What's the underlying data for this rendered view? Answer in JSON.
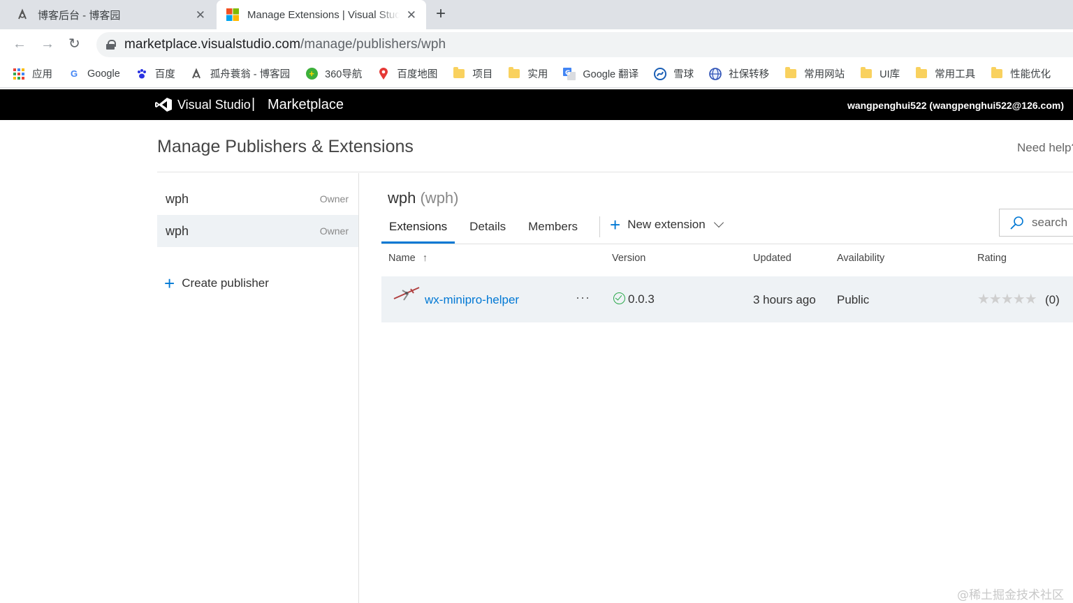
{
  "browser": {
    "tabs": [
      {
        "title": "博客后台 - 博客园",
        "active": false
      },
      {
        "title": "Manage Extensions | Visual Studio Marketplace",
        "active": true
      }
    ],
    "close_glyph": "✕",
    "new_tab_glyph": "+",
    "back_glyph": "←",
    "forward_glyph": "→",
    "reload_glyph": "↻",
    "url_host": "marketplace.visualstudio.com",
    "url_path": "/manage/publishers/wph",
    "bookmarks": [
      {
        "label": "应用",
        "icon": "apps-grid-icon"
      },
      {
        "label": "Google",
        "icon": "google-icon"
      },
      {
        "label": "百度",
        "icon": "baidu-paw-icon"
      },
      {
        "label": "孤舟蓑翁 - 博客园",
        "icon": "cnblogs-icon"
      },
      {
        "label": "360导航",
        "icon": "360-icon"
      },
      {
        "label": "百度地图",
        "icon": "map-pin-icon"
      },
      {
        "label": "项目",
        "icon": "folder-icon"
      },
      {
        "label": "实用",
        "icon": "folder-icon"
      },
      {
        "label": "Google 翻译",
        "icon": "google-translate-icon"
      },
      {
        "label": "雪球",
        "icon": "xueqiu-icon"
      },
      {
        "label": "社保转移",
        "icon": "globe-icon"
      },
      {
        "label": "常用网站",
        "icon": "folder-icon"
      },
      {
        "label": "UI库",
        "icon": "folder-icon"
      },
      {
        "label": "常用工具",
        "icon": "folder-icon"
      },
      {
        "label": "性能优化",
        "icon": "folder-icon"
      }
    ]
  },
  "header": {
    "brand": "Visual Studio",
    "separator": "|",
    "section": "Marketplace",
    "user": "wangpenghui522 (wangpenghui522@126.com)"
  },
  "page": {
    "title": "Manage Publishers & Extensions",
    "need_help": "Need help?"
  },
  "publishers": [
    {
      "name": "wph",
      "role": "Owner",
      "selected": false
    },
    {
      "name": "wph",
      "role": "Owner",
      "selected": true
    }
  ],
  "create_publisher": "Create publisher",
  "publisher_heading": {
    "name": "wph",
    "id": "(wph)"
  },
  "tabs": {
    "extensions": "Extensions",
    "details": "Details",
    "members": "Members",
    "new_extension": "New extension"
  },
  "search_placeholder": "search",
  "table": {
    "headers": {
      "name": "Name",
      "sort_glyph": "↑",
      "version": "Version",
      "updated": "Updated",
      "availability": "Availability",
      "rating": "Rating"
    },
    "rows": [
      {
        "name": "wx-minipro-helper",
        "more": "···",
        "version": "0.0.3",
        "updated": "3 hours ago",
        "availability": "Public",
        "stars": "★★★★★",
        "count": "(0)"
      }
    ]
  },
  "watermark": "@稀土掘金技术社区",
  "colors": {
    "accent": "#0078d4",
    "success": "#2aa84a",
    "header_bg": "#000000",
    "selected_bg": "#eef2f5"
  }
}
